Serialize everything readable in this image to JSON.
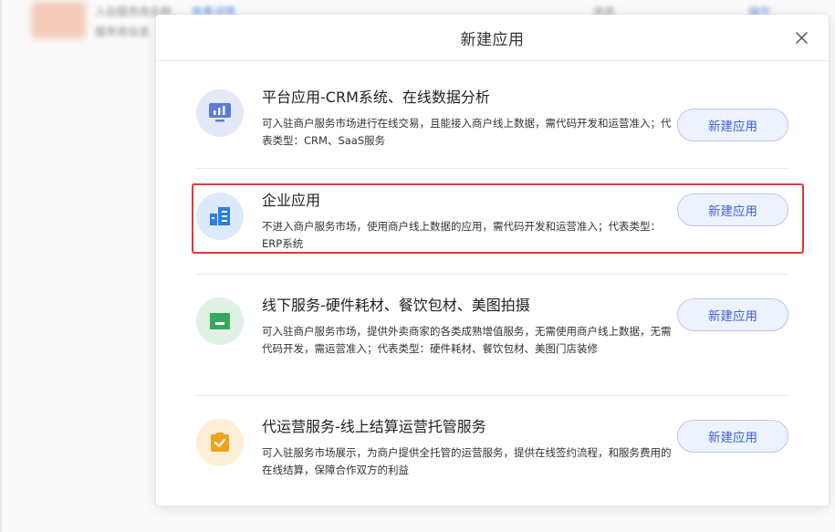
{
  "background": {
    "text_1": "入驻服务商名称",
    "text_2": "查看详情",
    "text_3": "服务商信息",
    "text_4": "状态",
    "text_5": "操作"
  },
  "modal": {
    "title": "新建应用",
    "close_icon": "close-icon",
    "cards": [
      {
        "icon": "chart-monitor-icon",
        "icon_color": "#5b7bd8",
        "icon_bg": "#e3e9f9",
        "title": "平台应用-CRM系统、在线数据分析",
        "desc": "可入驻商户服务市场进行在线交易，且能接入商户线上数据，需代码开发和运营准入；代表类型：CRM、SaaS服务",
        "button": "新建应用"
      },
      {
        "icon": "building-icon",
        "icon_color": "#2e7de0",
        "icon_bg": "#dceafb",
        "title": "企业应用",
        "desc": "不进入商户服务市场，使用商户线上数据的应用，需代码开发和运营准入；代表类型： ERP系统",
        "button": "新建应用"
      },
      {
        "icon": "storefront-icon",
        "icon_color": "#3aa85c",
        "icon_bg": "#dff2e3",
        "title": "线下服务-硬件耗材、餐饮包材、美图拍摄",
        "desc": "可入驻商户服务市场，提供外卖商家的各类成熟增值服务，无需使用商户线上数据，无需代码开发，需运营准入；代表类型：硬件耗材、餐饮包材、美图门店装修",
        "button": "新建应用"
      },
      {
        "icon": "clipboard-check-icon",
        "icon_color": "#f0a21c",
        "icon_bg": "#fcefd6",
        "title": "代运营服务-线上结算运营托管服务",
        "desc": "可入驻服务市场展示，为商户提供全托管的运营服务，提供在线签约流程，和服务费用的在线结算，保障合作双方的利益",
        "button": "新建应用"
      }
    ]
  },
  "highlight_color": "#e53935"
}
